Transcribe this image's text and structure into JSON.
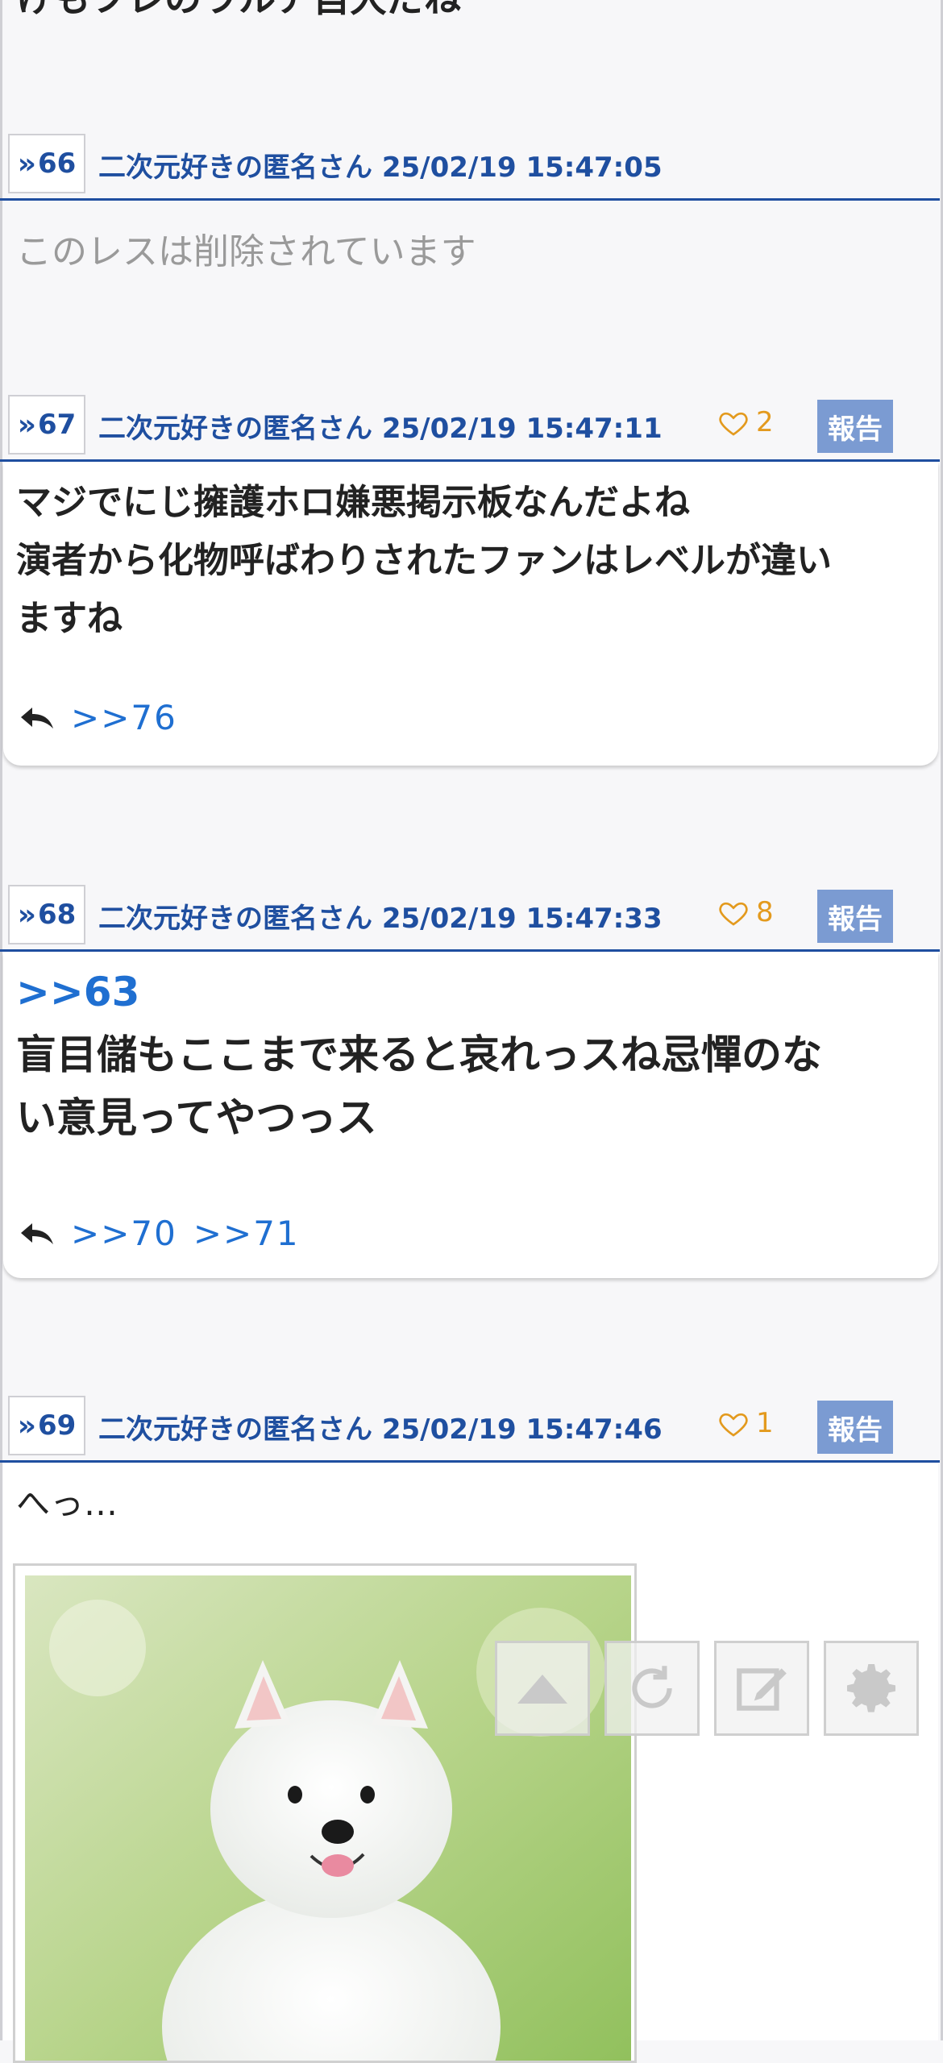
{
  "top_partial_text": "けもフレのウルア自大だね",
  "posts": [
    {
      "number": "66",
      "author": "二次元好きの匿名さん",
      "datetime": "25/02/19 15:47:05",
      "deleted_text": "このレスは削除されています"
    },
    {
      "number": "67",
      "author": "二次元好きの匿名さん",
      "datetime": "25/02/19 15:47:11",
      "likes": "2",
      "report_label": "報告",
      "lines": [
        "マジでにじ擁護ホロ嫌悪掲示板なんだよね",
        "演者から化物呼ばわりされたファンはレベルが違い",
        "ますね"
      ],
      "replies": [
        ">>76"
      ]
    },
    {
      "number": "68",
      "author": "二次元好きの匿名さん",
      "datetime": "25/02/19 15:47:33",
      "likes": "8",
      "report_label": "報告",
      "anchor": ">>63",
      "lines": [
        "盲目儲もここまで来ると哀れっスね忌憚のな",
        "い意見ってやつっス"
      ],
      "replies": [
        ">>70",
        ">>71"
      ]
    },
    {
      "number": "69",
      "author": "二次元好きの匿名さん",
      "datetime": "25/02/19 15:47:46",
      "likes": "1",
      "report_label": "報告",
      "lines": [
        "へっ…"
      ]
    }
  ],
  "floating_toolbar": {
    "icons": [
      "scroll-top-icon",
      "refresh-icon",
      "compose-icon",
      "settings-icon"
    ]
  },
  "colors": {
    "accent_blue": "#1f4fa0",
    "link_blue": "#1f6fd1",
    "like_orange": "#e39a1e",
    "report_bg": "#7b9bd2"
  }
}
